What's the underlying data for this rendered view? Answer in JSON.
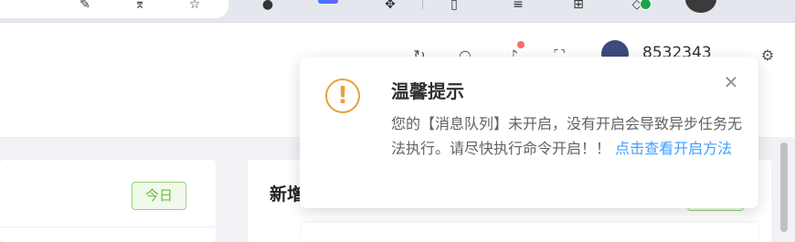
{
  "browser_toolbar": {
    "icons": [
      "brush-icon",
      "pin-icon",
      "star-icon",
      "ai-assistant-icon",
      "ai-badge-icon",
      "extension-icon",
      "split-screen-icon",
      "reading-list-icon",
      "collections-icon",
      "shield-check-icon",
      "profile-avatar"
    ]
  },
  "header": {
    "icons": [
      "refresh-icon",
      "search-icon",
      "bell-icon",
      "fullscreen-icon",
      "settings-icon"
    ],
    "username": "8532343",
    "notification_dot_color": "#f56c6c"
  },
  "cards": {
    "left": {
      "tag": "今日",
      "tag_color": "#67c23a"
    },
    "right": {
      "title": "新增"
    }
  },
  "notification": {
    "icon": "warning-icon",
    "accent_color": "#e6a23c",
    "title": "温馨提示",
    "message": "您的【消息队列】未开启，没有开启会导致异步任务无法执行。请尽快执行命令开启！！",
    "link_text": "点击查看开启方法",
    "link_color": "#409eff",
    "close_icon": "close-icon"
  }
}
